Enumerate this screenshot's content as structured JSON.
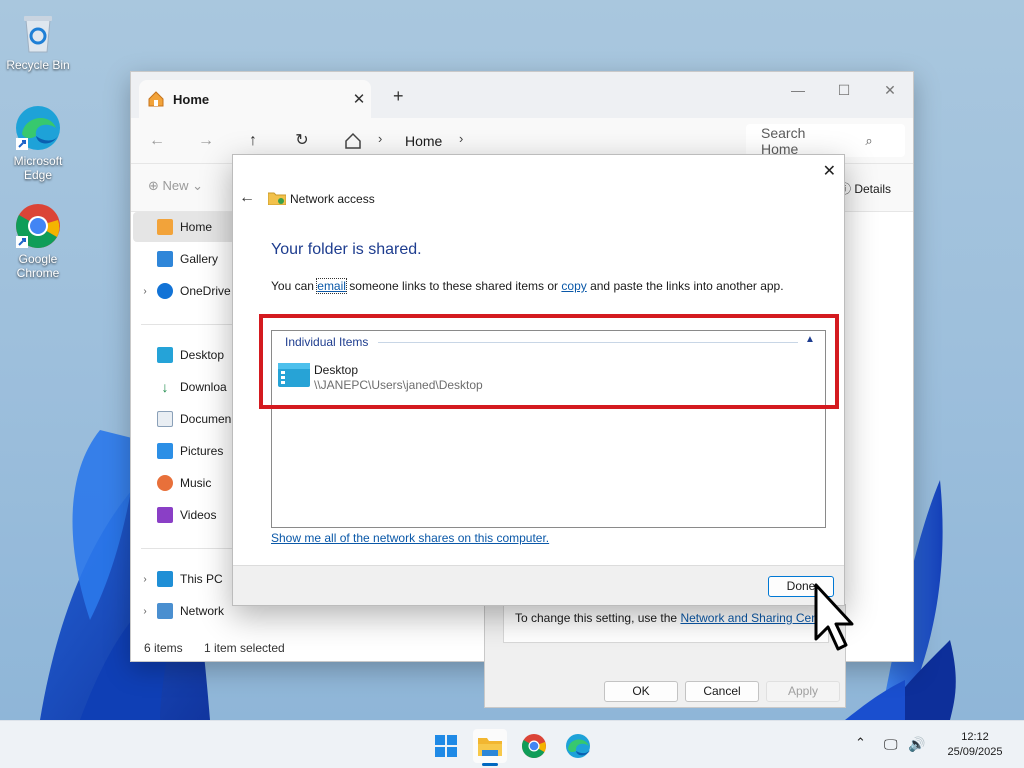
{
  "desktop": {
    "icons": [
      {
        "label": "Recycle Bin",
        "icon": "recycle-bin-icon"
      },
      {
        "label": "Microsoft Edge",
        "icon": "edge-icon"
      },
      {
        "label": "Google Chrome",
        "icon": "chrome-icon"
      }
    ]
  },
  "explorer": {
    "tab_label": "Home",
    "breadcrumb": "Home",
    "search_placeholder": "Search Home",
    "new_label": "New",
    "details_label": "Details",
    "sidebar": [
      {
        "label": "Home",
        "icon": "home-icon",
        "selected": true
      },
      {
        "label": "Gallery",
        "icon": "gallery-icon"
      },
      {
        "label": "OneDrive",
        "icon": "onedrive-icon",
        "expandable": true
      },
      {
        "label": "Desktop",
        "icon": "desktop-folder-icon"
      },
      {
        "label": "Downloa",
        "icon": "downloads-icon"
      },
      {
        "label": "Documen",
        "icon": "documents-icon"
      },
      {
        "label": "Pictures",
        "icon": "pictures-icon"
      },
      {
        "label": "Music",
        "icon": "music-icon"
      },
      {
        "label": "Videos",
        "icon": "videos-icon"
      },
      {
        "label": "This PC",
        "icon": "this-pc-icon",
        "expandable": true
      },
      {
        "label": "Network",
        "icon": "network-icon",
        "expandable": true
      }
    ],
    "status": {
      "items": "6 items",
      "selected": "1 item selected"
    }
  },
  "properties": {
    "setting_prefix": "To change this setting, use the ",
    "setting_link": "Network and Sharing Centre",
    "setting_suffix": ".",
    "ok": "OK",
    "cancel": "Cancel",
    "apply": "Apply"
  },
  "dialog": {
    "title": "Network access",
    "heading": "Your folder is shared.",
    "msg_part1": "You can ",
    "msg_email": "email",
    "msg_part2": " someone links to these shared items or ",
    "msg_copy": "copy",
    "msg_part3": " and paste the links into another app.",
    "items_header": "Individual Items",
    "item_name": "Desktop",
    "item_path": "\\\\JANEPC\\Users\\janed\\Desktop",
    "shares_link": "Show me all of the network shares on this computer.",
    "done": "Done"
  },
  "taskbar": {
    "time": "12:12",
    "date": "25/09/2025"
  },
  "colors": {
    "accent": "#0078d4",
    "highlight_frame": "#d41a1f",
    "heading_blue": "#1e3d8f",
    "link_blue": "#0a58a8"
  }
}
